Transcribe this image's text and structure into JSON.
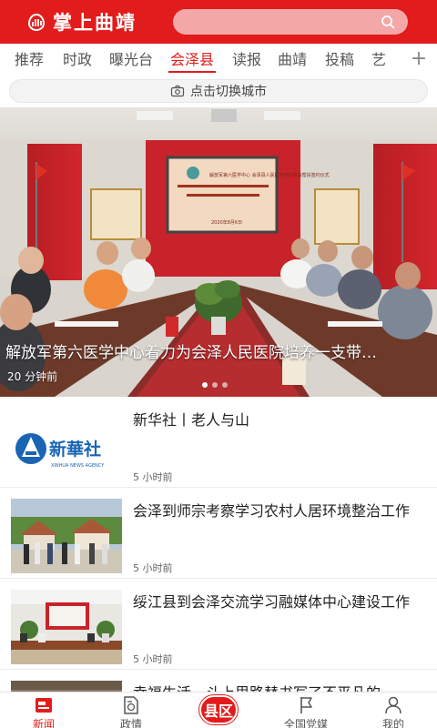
{
  "header": {
    "logo_text": "掌上曲靖",
    "search_placeholder": ""
  },
  "tabs": [
    {
      "label": "推荐"
    },
    {
      "label": "时政"
    },
    {
      "label": "曝光台"
    },
    {
      "label": "会泽县",
      "active": true
    },
    {
      "label": "读报"
    },
    {
      "label": "曲靖"
    },
    {
      "label": "投稿"
    },
    {
      "label": "艺"
    }
  ],
  "tab_add": "+",
  "city_switch": {
    "label": "点击切换城市",
    "icon": "location-camera-icon"
  },
  "banner": {
    "caption": "解放军第六医学中心着力为会泽人民医院培养一支带…",
    "time": "20 分钟前",
    "page_count": 3,
    "active_page": 1,
    "screen_title": "解放军第六医学中心 会泽县人民医院专科建设帮扶签约仪式",
    "screen_date": "2020年8月6日"
  },
  "news": [
    {
      "title": "新华社丨老人与山",
      "time": "5 小时前",
      "thumb": "xinhua-logo",
      "logo_cn": "新華社",
      "logo_en": "XINHUA NEWS AGENCY"
    },
    {
      "title": "会泽到师宗考察学习农村人居环境整治工作",
      "time": "5 小时前",
      "thumb": "village-photo"
    },
    {
      "title": "绥江县到会泽交流学习融媒体中心建设工作",
      "time": "5 小时前",
      "thumb": "meeting-photo"
    },
    {
      "title": "幸福生活…斗上里路替书写了不平凡的",
      "time": "",
      "thumb": "partial-photo"
    }
  ],
  "bottom_nav": [
    {
      "label": "新闻",
      "icon": "news-icon",
      "active": true
    },
    {
      "label": "政情",
      "icon": "document-icon"
    },
    {
      "label": "县区",
      "icon": "county-icon"
    },
    {
      "label": "全国党媒",
      "icon": "flag-icon"
    },
    {
      "label": "我的",
      "icon": "user-icon"
    }
  ],
  "colors": {
    "brand": "#e21c1c",
    "text": "#222222",
    "muted": "#666666"
  }
}
